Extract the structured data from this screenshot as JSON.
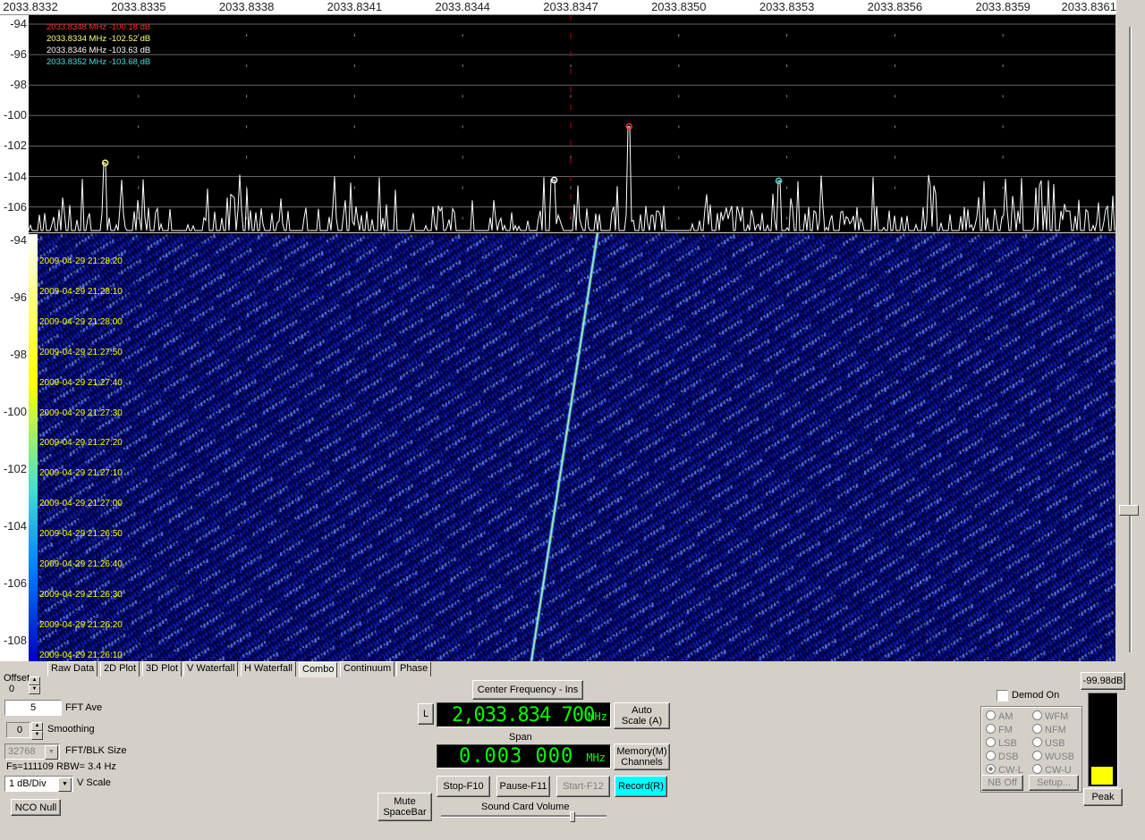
{
  "x_axis": {
    "ticks": [
      "2033.8332",
      "2033.8335",
      "2033.8338",
      "2033.8341",
      "2033.8344",
      "2033.8347",
      "2033.8350",
      "2033.8353",
      "2033.8356",
      "2033.8359",
      "2033.8361"
    ]
  },
  "spectrum_y_axis": {
    "ticks": [
      "-94",
      "-96",
      "-98",
      "-100",
      "-102",
      "-104",
      "-106"
    ]
  },
  "waterfall_y_axis": {
    "ticks": [
      "-94",
      "-96",
      "-98",
      "-100",
      "-102",
      "-104",
      "-106",
      "-108"
    ]
  },
  "markers": [
    {
      "text": "2033.8348 MHz  -100.18  dB",
      "color": "#ff3030"
    },
    {
      "text": "2033.8334 MHz  -102.52  dB",
      "color": "#ffff80"
    },
    {
      "text": "2033.8346 MHz  -103.63  dB",
      "color": "#ffffff"
    },
    {
      "text": "2033.8352 MHz  -103.68  dB",
      "color": "#40e0e0"
    }
  ],
  "timestamps": [
    "2009-04-29 21:28:20",
    "2009-04-29 21:28:10",
    "2009-04-29 21:28:00",
    "2009-04-29 21:27:50",
    "2009-04-29 21:27:40",
    "2009-04-29 21:27:30",
    "2009-04-29 21:27:20",
    "2009-04-29 21:27:10",
    "2009-04-29 21:27:00",
    "2009-04-29 21:26:50",
    "2009-04-29 21:26:40",
    "2009-04-29 21:26:30",
    "2009-04-29 21:26:20",
    "2009-04-29 21:26:10"
  ],
  "tabs": [
    "Raw Data",
    "2D Plot",
    "3D Plot",
    "V Waterfall",
    "H Waterfall",
    "Combo",
    "Continuum",
    "Phase"
  ],
  "active_tab": "Combo",
  "controls": {
    "offset_label": "Offset",
    "offset_value": "0",
    "fft_ave_value": "5",
    "fft_ave_label": "FFT Ave",
    "smoothing_value": "0",
    "smoothing_label": "Smoothing",
    "fft_blk_value": "32768",
    "fft_blk_label": "FFT/BLK Size",
    "fs_info": "Fs=111109 RBW= 3.4 Hz",
    "vscale_value": "1 dB/Div",
    "vscale_label": "V Scale",
    "nco_null": "NCO Null"
  },
  "center": {
    "center_freq_button": "Center Frequency - Ins",
    "l_button": "L",
    "freq_value": "2,033.834 700",
    "freq_unit": "MHz",
    "auto_scale": "Auto Scale (A)",
    "span_label": "Span",
    "span_value": "0.003 000",
    "span_unit": "MHz",
    "memory": "Memory(M) Channels",
    "mute": "Mute SpaceBar",
    "stop": "Stop-F10",
    "pause": "Pause-F11",
    "start": "Start-F12",
    "record": "Record(R)",
    "sound_volume_label": "Sound Card Volume",
    "sound_volume_level": 0.78
  },
  "demod": {
    "demod_on_label": "Demod On",
    "modes_left": [
      "AM",
      "FM",
      "LSB",
      "DSB",
      "CW-L"
    ],
    "modes_right": [
      "WFM",
      "NFM",
      "USB",
      "WUSB",
      "CW-U"
    ],
    "selected": "CW-L",
    "nb_off": "NB Off",
    "setup": "Setup..."
  },
  "meter": {
    "level_label": "-99.98dB",
    "peak": "Peak",
    "fill_fraction": 0.2
  },
  "chart_data": {
    "type": "line",
    "x_unit": "MHz",
    "xlim": [
      2033.8332,
      2033.8361
    ],
    "ylim": [
      -107,
      -93
    ],
    "peaks": [
      {
        "x": 2033.8348,
        "y": -100.18
      },
      {
        "x": 2033.8334,
        "y": -102.52
      },
      {
        "x": 2033.8346,
        "y": -103.63
      },
      {
        "x": 2033.8352,
        "y": -103.68
      }
    ],
    "noise_floor": -107,
    "grid": true
  }
}
